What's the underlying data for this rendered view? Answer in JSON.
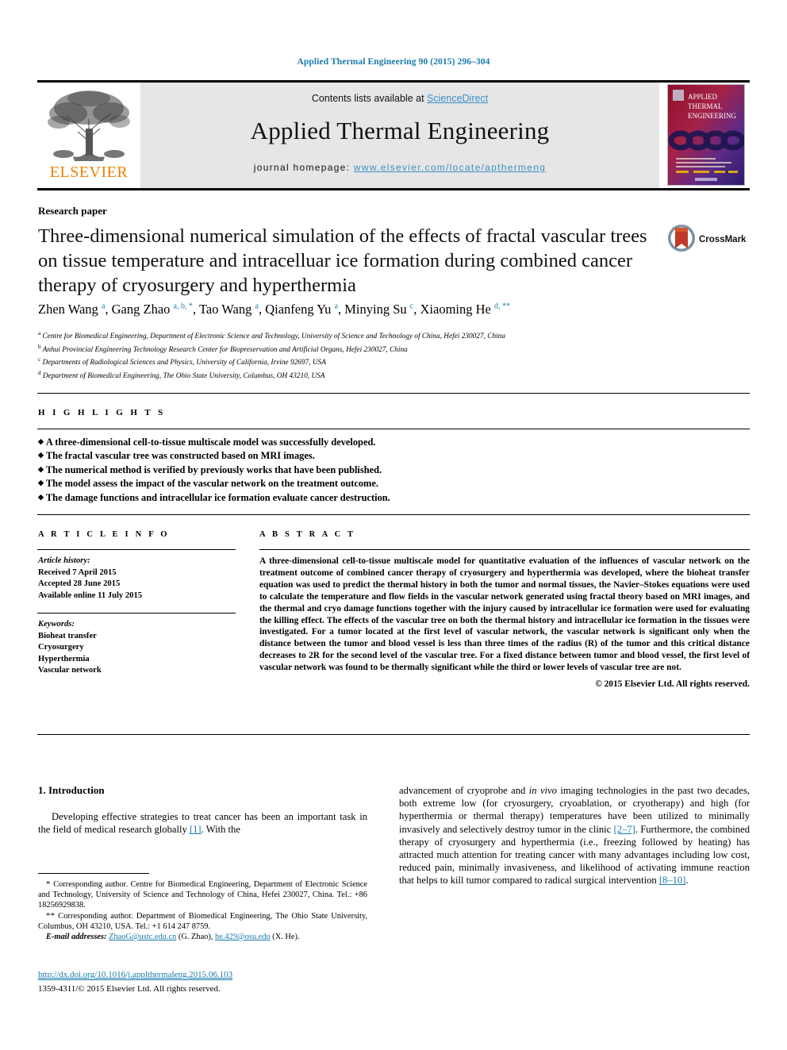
{
  "running_head": "Applied Thermal Engineering 90 (2015) 296–304",
  "masthead": {
    "publisher_name": "ELSEVIER",
    "contents_prefix": "Contents lists available at ",
    "contents_link": "ScienceDirect",
    "journal_title": "Applied Thermal Engineering",
    "homepage_label": "journal homepage: ",
    "homepage_url": "www.elsevier.com/locate/apthermeng",
    "cover": {
      "line1": "APPLIED",
      "line2": "THERMAL",
      "line3": "ENGINEERING"
    }
  },
  "article": {
    "section_type": "Research paper",
    "title": "Three-dimensional numerical simulation of the effects of fractal vascular trees on tissue temperature and intracelluar ice formation during combined cancer therapy of cryosurgery and hyperthermia",
    "crossmark_label": "CrossMark",
    "authors": [
      {
        "name": "Zhen Wang",
        "marks": "a"
      },
      {
        "name": "Gang Zhao",
        "marks": "a, b, *"
      },
      {
        "name": "Tao Wang",
        "marks": "a"
      },
      {
        "name": "Qianfeng Yu",
        "marks": "a"
      },
      {
        "name": "Minying Su",
        "marks": "c"
      },
      {
        "name": "Xiaoming He",
        "marks": "d, **"
      }
    ],
    "affiliations": [
      {
        "mark": "a",
        "text": "Centre for Biomedical Engineering, Department of Electronic Science and Technology, University of Science and Technology of China, Hefei 230027, China"
      },
      {
        "mark": "b",
        "text": "Anhui Provincial Engineering Technology Research Center for Biopreservation and Artificial Organs, Hefei 230027, China"
      },
      {
        "mark": "c",
        "text": "Departments of Radiological Sciences and Physics, University of California, Irvine 92697, USA"
      },
      {
        "mark": "d",
        "text": "Department of Biomedical Engineering, The Ohio State University, Columbus, OH 43210, USA"
      }
    ]
  },
  "highlights": {
    "heading": "H I G H L I G H T S",
    "items": [
      "A three-dimensional cell-to-tissue multiscale model was successfully developed.",
      "The fractal vascular tree was constructed based on MRI images.",
      "The numerical method is verified by previously works that have been published.",
      "The model assess the impact of the vascular network on the treatment outcome.",
      "The damage functions and intracellular ice formation evaluate cancer destruction."
    ]
  },
  "article_info": {
    "heading": "A R T I C L E  I N F O",
    "history_label": "Article history:",
    "history": [
      "Received 7 April 2015",
      "Accepted 28 June 2015",
      "Available online 11 July 2015"
    ],
    "keywords_label": "Keywords:",
    "keywords": [
      "Bioheat transfer",
      "Cryosurgery",
      "Hyperthermia",
      "Vascular network"
    ]
  },
  "abstract": {
    "heading": "A B S T R A C T",
    "text": "A three-dimensional cell-to-tissue multiscale model for quantitative evaluation of the influences of vascular network on the treatment outcome of combined cancer therapy of cryosurgery and hyperthermia was developed, where the bioheat transfer equation was used to predict the thermal history in both the tumor and normal tissues, the Navier–Stokes equations were used to calculate the temperature and flow fields in the vascular network generated using fractal theory based on MRI images, and the thermal and cryo damage functions together with the injury caused by intracellular ice formation were used for evaluating the killing effect. The effects of the vascular tree on both the thermal history and intracellular ice formation in the tissues were investigated. For a tumor located at the first level of vascular network, the vascular network is significant only when the distance between the tumor and blood vessel is less than three times of the radius (R) of the tumor and this critical distance decreases to 2R for the second level of the vascular tree. For a fixed distance between tumor and blood vessel, the first level of vascular network was found to be thermally significant while the third or lower levels of vascular tree are not.",
    "copyright": "© 2015 Elsevier Ltd. All rights reserved."
  },
  "body": {
    "section_number_title": "1. Introduction",
    "left_paragraph": "Developing effective strategies to treat cancer has been an important task in the field of medical research globally [1]. With the",
    "left_ref": "[1]",
    "right_paragraph_part1": "advancement of cryoprobe and ",
    "right_italic": "in vivo",
    "right_paragraph_part2": " imaging technologies in the past two decades, both extreme low (for cryosurgery, cryoablation, or cryotherapy) and high (for hyperthermia or thermal therapy) temperatures have been utilized to minimally invasively and selectively destroy tumor in the clinic ",
    "right_ref1": "[2–7]",
    "right_paragraph_part3": ". Furthermore, the combined therapy of cryosurgery and hyperthermia (i.e., freezing followed by heating) has attracted much attention for treating cancer with many advantages including low cost, reduced pain, minimally invasiveness, and likelihood of activating immune reaction that helps to kill tumor compared to radical surgical intervention ",
    "right_ref2": "[8–10]",
    "right_paragraph_end": "."
  },
  "footnotes": {
    "corresponding1_mark": "*",
    "corresponding1": "Corresponding author. Centre for Biomedical Engineering, Department of Electronic Science and Technology, University of Science and Technology of China, Hefei 230027, China. Tel.: +86 18256929838.",
    "corresponding2_mark": "**",
    "corresponding2": "Corresponding author. Department of Biomedical Engineering, The Ohio State University, Columbus, OH 43210, USA. Tel.: +1 614 247 8759.",
    "email_label": "E-mail addresses:",
    "email1": "ZhaoG@ustc.edu.cn",
    "email1_owner": "(G. Zhao),",
    "email2": "he.429@osu.edu",
    "email2_owner": "(X. He).",
    "doi": "http://dx.doi.org/10.1016/j.applthermaleng.2015.06.103",
    "issn_line": "1359-4311/© 2015 Elsevier Ltd. All rights reserved."
  },
  "colors": {
    "link_blue": "#1a7aab",
    "sd_blue": "#3a8fc4",
    "elsevier_orange": "#ef8200",
    "masthead_gray": "#e6e6e6"
  }
}
